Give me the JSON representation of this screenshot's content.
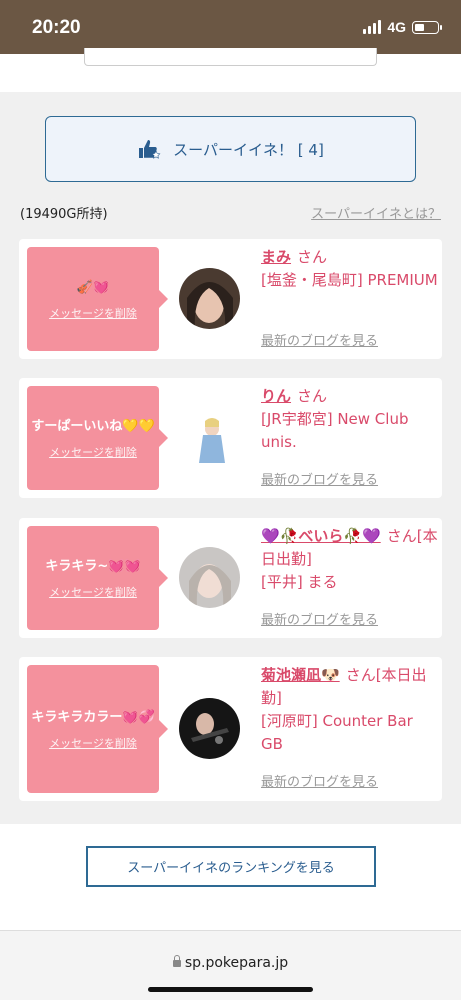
{
  "status_bar": {
    "time": "20:20",
    "network": "4G"
  },
  "super_like_button": {
    "label": "スーパーイイネ！ [ 4]"
  },
  "points_owned": "(19490G所持)",
  "what_is_link": "スーパーイイネとは？",
  "cards": [
    {
      "message": "🎻💓",
      "delete_label": "メッセージを削除",
      "name": "まみ",
      "san": "さん",
      "shop": "[塩釜・尾島町] PREMIUM",
      "blog_label": "最新のブログを見る"
    },
    {
      "message": "すーぱーいいね💛💛",
      "delete_label": "メッセージを削除",
      "name": "りん",
      "san": "さん",
      "shop": "[JR宇都宮] New Club unis.",
      "blog_label": "最新のブログを見る"
    },
    {
      "message": "キラキラ~💓💓",
      "delete_label": "メッセージを削除",
      "name": "💜🥀べいら🥀💜",
      "san": "さん[本日出勤]",
      "shop": "[平井] まる",
      "blog_label": "最新のブログを見る"
    },
    {
      "message": "キラキラカラー💓💞",
      "delete_label": "メッセージを削除",
      "name": "菊池瀬凪🐶",
      "san": "さん[本日出勤]",
      "shop": "[河原町] Counter Bar GB",
      "blog_label": "最新のブログを見る"
    }
  ],
  "ranking_button": {
    "label": "スーパーイイネのランキングを見る"
  },
  "address_bar": {
    "url": "sp.pokepara.jp"
  },
  "colors": {
    "accent_blue": "#2e6a94",
    "pink_bubble": "#f4919d",
    "name_pink": "#d94a6a",
    "status_brown": "#6b5744"
  }
}
